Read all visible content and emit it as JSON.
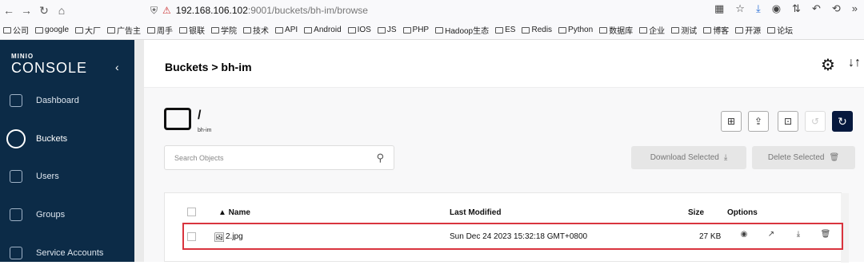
{
  "browser": {
    "url_host": "192.168.106.102",
    "url_path": ":9001/buckets/bh-im/browse",
    "bookmarks": [
      "公司",
      "google",
      "大厂",
      "广告主",
      "周手",
      "银联",
      "学院",
      "技术",
      "API",
      "Android",
      "IOS",
      "JS",
      "PHP",
      "Hadoop生态",
      "ES",
      "Redis",
      "Python",
      "数据库",
      "企业",
      "测试",
      "博客",
      "开源",
      "论坛"
    ]
  },
  "sidebar": {
    "logo_small": "MINIO",
    "logo_big": "CONSOLE",
    "collapse_label": "‹",
    "items": [
      {
        "label": "Dashboard"
      },
      {
        "label": "Buckets"
      },
      {
        "label": "Users"
      },
      {
        "label": "Groups"
      },
      {
        "label": "Service Accounts"
      }
    ]
  },
  "header": {
    "breadcrumb": "Buckets > bh-im"
  },
  "bucket": {
    "path": "/",
    "name": "bh-im"
  },
  "search": {
    "placeholder": "Search Objects"
  },
  "actions": {
    "download_selected": "Download Selected",
    "delete_selected": "Delete Selected"
  },
  "table": {
    "columns": {
      "name": "▲ Name",
      "last_modified": "Last Modified",
      "size": "Size",
      "options": "Options"
    },
    "rows": [
      {
        "name": "2.jpg",
        "last_modified": "Sun Dec 24 2023 15:32:18 GMT+0800",
        "size": "27 KB"
      }
    ]
  }
}
